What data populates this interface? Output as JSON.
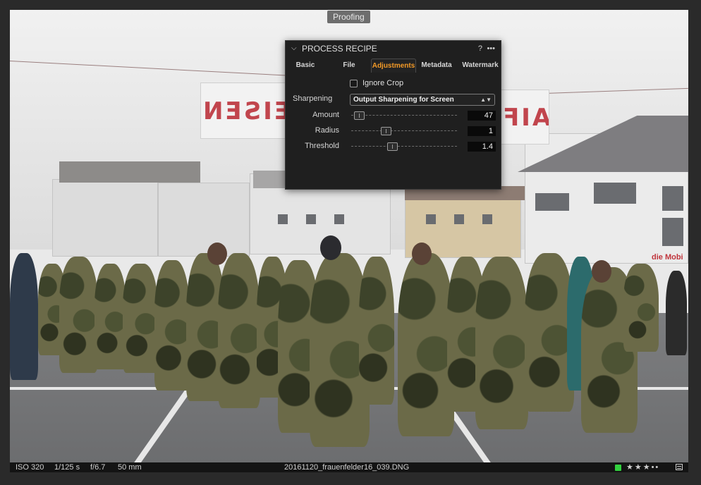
{
  "viewer": {
    "proofing_label": "Proofing",
    "banner_left_text": "RAIFFEISEN",
    "banner_right_text": "RAIF",
    "shop_sign_text": "die Mobi"
  },
  "panel": {
    "title": "PROCESS RECIPE",
    "help_icon": "?",
    "more_icon": "•••",
    "tabs": [
      "Basic",
      "File",
      "Adjustments",
      "Metadata",
      "Watermark"
    ],
    "active_tab": "Adjustments",
    "ignore_crop_label": "Ignore Crop",
    "ignore_crop_checked": false,
    "sharpening_label": "Sharpening",
    "sharpening_value": "Output Sharpening for Screen",
    "sliders": [
      {
        "label": "Amount",
        "value": "47",
        "fraction": 0.03
      },
      {
        "label": "Radius",
        "value": "1",
        "fraction": 0.31
      },
      {
        "label": "Threshold",
        "value": "1.4",
        "fraction": 0.38
      }
    ]
  },
  "status_bar": {
    "iso": "ISO 320",
    "shutter": "1/125 s",
    "aperture": "f/6.7",
    "focal_length": "50 mm",
    "filename": "20161120_frauenfelder16_039.DNG",
    "color_tag": "#31d13e",
    "rating_dots": "★★★••",
    "menu_icon": "list-icon"
  }
}
